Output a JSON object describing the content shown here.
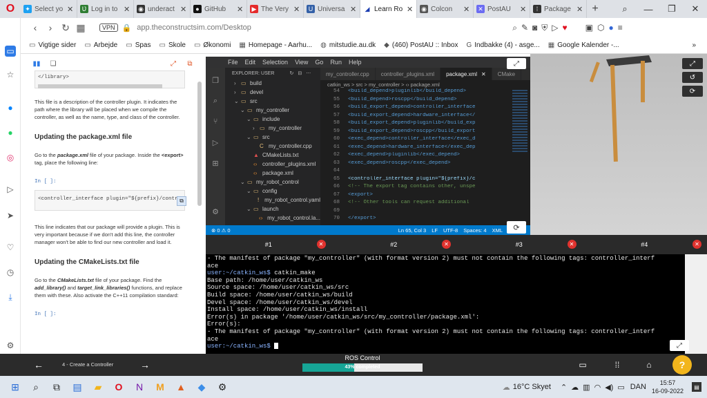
{
  "browser": {
    "tabs": [
      {
        "label": "Select yo",
        "fav": "#1da1f2",
        "icon": "✦"
      },
      {
        "label": "Log in to",
        "fav": "#2e7d32",
        "icon": "Ʋ"
      },
      {
        "label": "underact",
        "fav": "#333",
        "icon": "◉"
      },
      {
        "label": "GitHub",
        "fav": "#111",
        "icon": "●"
      },
      {
        "label": "The Very",
        "fav": "#e52b2b",
        "icon": "▶"
      },
      {
        "label": "Universa",
        "fav": "#3461a8",
        "icon": "U"
      },
      {
        "label": "Learn Ro",
        "fav": "#fff",
        "icon": "◢"
      },
      {
        "label": "Colcon",
        "fav": "#555",
        "icon": "◉"
      },
      {
        "label": "PostAU",
        "fav": "#6c6cf2",
        "icon": "✕"
      },
      {
        "label": "Package",
        "fav": "#333",
        "icon": "⁞"
      }
    ],
    "active_tab": 6,
    "vpn": "VPN",
    "url": "app.theconstructsim.com/Desktop",
    "bookmarks": [
      "Vigtige sider",
      "Arbejde",
      "Spas",
      "Skole",
      "Økonomi",
      "Homepage - Aarhu...",
      "mitstudie.au.dk",
      "(460) PostAU :: Inbox",
      "Indbakke (4) - asge...",
      "Google Kalender -..."
    ]
  },
  "notebook": {
    "top_code": "</library>",
    "p1": "This file is a description of the controller plugin. It indicates the path where the library will be placed when we compile the controller, as well as the name, type, and class of the controller.",
    "h1": "Updating the package.xml file",
    "p2a": "Go to the ",
    "p2b": "package.xml",
    "p2c": " file of your package. Inside the ",
    "p2d": "<export>",
    "p2e": " tag, place the following line:",
    "in1": "In [ ]:",
    "code1": "<controller_interface plugin=\"${prefix}/contr",
    "p3": "This line indicates that our package will provide a plugin. This is very important because if we don't add this line, the controller manager won't be able to find our new controller and load it.",
    "h2": "Updating the CMakeLists.txt file",
    "p4a": "Go to the ",
    "p4b": "CMakeLists.txt",
    "p4c": " file of your package. Find the ",
    "p4d": "add_library()",
    "p4e": " and ",
    "p4f": "target_link_libraries()",
    "p4g": " functions, and replace them with these. Also activate the C++11 compilation standard:",
    "in2": "In [ ]:"
  },
  "vscode": {
    "menu": [
      "File",
      "Edit",
      "Selection",
      "View",
      "Go",
      "Run",
      "Help"
    ],
    "explorer_title": "EXPLORER: USER",
    "tree": [
      {
        "label": "build",
        "indent": 1,
        "type": "folder"
      },
      {
        "label": "devel",
        "indent": 1,
        "type": "folder"
      },
      {
        "label": "src",
        "indent": 1,
        "type": "folder-open"
      },
      {
        "label": "my_controller",
        "indent": 2,
        "type": "folder-open"
      },
      {
        "label": "include",
        "indent": 3,
        "type": "folder-open"
      },
      {
        "label": "my_controller",
        "indent": 4,
        "type": "folder"
      },
      {
        "label": "src",
        "indent": 3,
        "type": "folder-open"
      },
      {
        "label": "my_controller.cpp",
        "indent": 4,
        "type": "cpp"
      },
      {
        "label": "CMakeLists.txt",
        "indent": 3,
        "type": "cmake"
      },
      {
        "label": "controller_plugins.xml",
        "indent": 3,
        "type": "xml"
      },
      {
        "label": "package.xml",
        "indent": 3,
        "type": "xml"
      },
      {
        "label": "my_robot_control",
        "indent": 2,
        "type": "folder-open"
      },
      {
        "label": "config",
        "indent": 3,
        "type": "folder-open"
      },
      {
        "label": "my_robot_control.yaml",
        "indent": 4,
        "type": "yaml"
      },
      {
        "label": "launch",
        "indent": 3,
        "type": "folder-open"
      },
      {
        "label": "my_robot_control.la...",
        "indent": 4,
        "type": "xml"
      }
    ],
    "tabs": [
      "my_controller.cpp",
      "controller_plugins.xml",
      "package.xml",
      "CMake"
    ],
    "active_tab": 2,
    "breadcrumb": "catkin_ws > src > my_controller > ‹› package.xml",
    "lines": [
      {
        "n": "54",
        "t": "<build_depend>pluginlib</build_depend>",
        "c": "tg"
      },
      {
        "n": "55",
        "t": "<build_depend>roscpp</build_depend>",
        "c": "tg"
      },
      {
        "n": "56",
        "t": "<build_export_depend>controller_interface",
        "c": "tg"
      },
      {
        "n": "57",
        "t": "<build_export_depend>hardware_interface</",
        "c": "tg"
      },
      {
        "n": "58",
        "t": "<build_export_depend>pluginlib</build_exp",
        "c": "tg"
      },
      {
        "n": "59",
        "t": "<build_export_depend>roscpp</build_export",
        "c": "tg"
      },
      {
        "n": "60",
        "t": "<exec_depend>controller_interface</exec_d",
        "c": "tg"
      },
      {
        "n": "61",
        "t": "<exec_depend>hardware_interface</exec_dep",
        "c": "tg"
      },
      {
        "n": "62",
        "t": "<exec_depend>pluginlib</exec_depend>",
        "c": "tg"
      },
      {
        "n": "63",
        "t": "<exec_depend>roscpp</exec_depend>",
        "c": "tg"
      },
      {
        "n": "64",
        "t": "",
        "c": "tx"
      },
      {
        "n": "65",
        "t": "<controller_interface plugin=\"${prefix}/c",
        "c": "tx"
      },
      {
        "n": "66",
        "t": "<!-- The export tag contains other, unspe",
        "c": "cm"
      },
      {
        "n": "67",
        "t": "<export>",
        "c": "tg"
      },
      {
        "n": "68",
        "t": "  <!-- Other tools can request additional",
        "c": "cm"
      },
      {
        "n": "69",
        "t": "",
        "c": "tx"
      },
      {
        "n": "70",
        "t": "</export>",
        "c": "tg"
      }
    ],
    "status_left": "⊗ 0 ⚠ 0",
    "status_right": [
      "Ln 65, Col 3",
      "LF",
      "UTF-8",
      "Spaces: 4",
      "XML"
    ]
  },
  "terminal": {
    "tabs": [
      "#1",
      "#2",
      "#3",
      "#4"
    ],
    "lines": [
      {
        "t": "- The manifest of package \"my_controller\" (with format version 2) must not contain the following tags: controller_interf"
      },
      {
        "t": "ace"
      },
      {
        "p": "user:~/catkin_ws$",
        "t": " catkin_make"
      },
      {
        "t": "Base path: /home/user/catkin_ws"
      },
      {
        "t": "Source space: /home/user/catkin_ws/src"
      },
      {
        "t": "Build space: /home/user/catkin_ws/build"
      },
      {
        "t": "Devel space: /home/user/catkin_ws/devel"
      },
      {
        "t": "Install space: /home/user/catkin_ws/install"
      },
      {
        "t": "Error(s) in package '/home/user/catkin_ws/src/my_controller/package.xml':"
      },
      {
        "t": "Error(s):"
      },
      {
        "t": "- The manifest of package \"my_controller\" (with format version 2) must not contain the following tags: controller_interf"
      },
      {
        "t": "ace"
      },
      {
        "p": "user:~/catkin_ws$",
        "t": " ",
        "cursor": true
      }
    ]
  },
  "course": {
    "chapter": "4 - Create a Controller",
    "title": "ROS Control",
    "progress_pct": 43,
    "progress_label": "43% completed",
    "help": "?"
  },
  "taskbar": {
    "weather": "16°C  Skyet",
    "lang": "DAN",
    "time": "15:57",
    "date": "16-09-2022"
  },
  "colors": {
    "accent": "#16a596",
    "terminal_prompt": "#8ab4ff",
    "vscode_status": "#007acc",
    "help": "#f2b51c"
  }
}
